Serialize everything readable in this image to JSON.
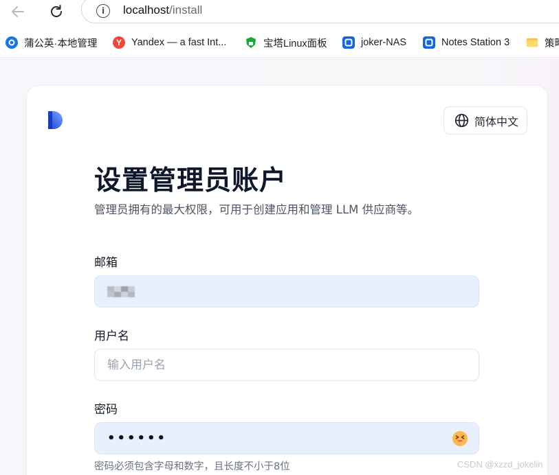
{
  "browser": {
    "url_host": "localhost",
    "url_path": "/install",
    "bookmarks": [
      {
        "label": "蒲公英·本地管理",
        "icon": "dandelion-icon",
        "color": "#1a73e8"
      },
      {
        "label": "Yandex — a fast Int...",
        "icon": "yandex-icon",
        "color": "#f0463c"
      },
      {
        "label": "宝塔Linux面板",
        "icon": "bt-panel-icon",
        "color": "#20a53a"
      },
      {
        "label": "joker-NAS",
        "icon": "qnap-icon",
        "color": "#1565e0"
      },
      {
        "label": "Notes Station 3",
        "icon": "qnap-icon",
        "color": "#1565e0"
      },
      {
        "label": "策略",
        "icon": "folder-icon",
        "color": "#f5c242"
      }
    ]
  },
  "page": {
    "language_button": "简体中文",
    "title": "设置管理员账户",
    "subtitle": "管理员拥有的最大权限，可用于创建应用和管理 LLM 供应商等。",
    "email": {
      "label": "邮箱"
    },
    "username": {
      "label": "用户名",
      "placeholder": "输入用户名",
      "value": ""
    },
    "password": {
      "label": "密码",
      "masked_value": "••••••",
      "hint": "密码必须包含字母和数字，且长度不小于8位"
    }
  },
  "watermark": "CSDN @xzzd_jokelin",
  "colors": {
    "accent": "#1c64f2",
    "field_fill": "#e8effd"
  }
}
